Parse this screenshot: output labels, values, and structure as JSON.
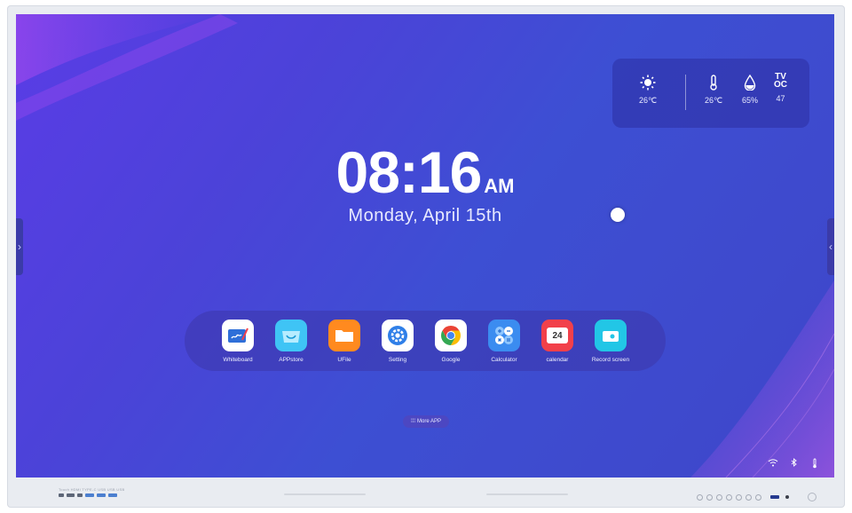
{
  "weather": {
    "temp": "26℃",
    "indoor_temp": "26℃",
    "humidity": "65%",
    "tvoc_label_top": "TV",
    "tvoc_label_bottom": "OC",
    "tvoc_value": "47"
  },
  "clock": {
    "time": "08:16",
    "ampm": "AM",
    "date": "Monday, April 15th"
  },
  "apps": [
    {
      "label": "Whiteboard",
      "icon": "whiteboard-icon",
      "color": "#ffffff"
    },
    {
      "label": "APPstore",
      "icon": "appstore-icon",
      "color": "#3fc4f5"
    },
    {
      "label": "UFile",
      "icon": "folder-icon",
      "color": "#ff8a1f"
    },
    {
      "label": "Setting",
      "icon": "gear-icon",
      "color": "#ffffff"
    },
    {
      "label": "Google",
      "icon": "chrome-icon",
      "color": "#ffffff"
    },
    {
      "label": "Calculator",
      "icon": "calculator-icon",
      "color": "#3b8cf0"
    },
    {
      "label": "calendar",
      "icon": "calendar-icon",
      "color": "#f2404a"
    },
    {
      "label": "Record screen",
      "icon": "record-icon",
      "color": "#22c6e6"
    }
  ],
  "calendar_day": "24",
  "more_apps": "More APP",
  "ports": {
    "labels": "Touch  HDMI  TYPE-C  USB  USB  USB"
  }
}
